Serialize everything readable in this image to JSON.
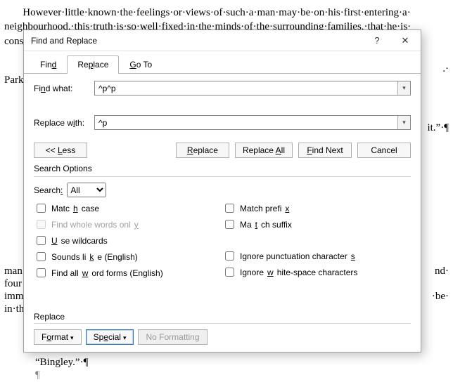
{
  "doc": {
    "line1": "       However·little·known·the·feelings·or·views·of·such·a·man·may·be·on·his·first·entering·a·",
    "line2": "neighbourhood,·this·truth·is·so·well·fixed·in·the·minds·of·the·surrounding·families,·that·he·is·",
    "line3": "cons",
    "parkFrag": "Park",
    "itFrag": "it.”·¶",
    "manFrag": "man",
    "fourFrag": "four",
    "immFrag": "imm",
    "inthFrag": "in·th",
    "beFrag": "·be·",
    "bingley": "“Bingley.”·¶",
    "ndFrag": "nd·",
    "dotFrag": ".·",
    "pil": "¶"
  },
  "dialog": {
    "title": "Find and Replace",
    "help": "?",
    "close": "✕",
    "tabs": {
      "find": "Find",
      "replace": "Replace",
      "goto": "Go To"
    },
    "findLabel": "Find what:",
    "findValue": "^p^p",
    "replaceLabel": "Replace with:",
    "replaceValue": "^p",
    "less": "<< Less",
    "replaceBtn": "Replace",
    "replaceAll": "Replace All",
    "findNext": "Find Next",
    "cancel": "Cancel",
    "searchOptions": "Search Options",
    "searchLbl": "Search:",
    "searchSel": "All",
    "matchCase": "Match case",
    "wholeWords": "Find whole words only",
    "wildcards": "Use wildcards",
    "sounds": "Sounds like (English)",
    "wordforms": "Find all word forms (English)",
    "prefix": "Match prefix",
    "suffix": "Match suffix",
    "punct": "Ignore punctuation characters",
    "white": "Ignore white-space characters",
    "replaceGroup": "Replace",
    "format": "Format",
    "special": "Special",
    "noformat": "No Formatting"
  }
}
